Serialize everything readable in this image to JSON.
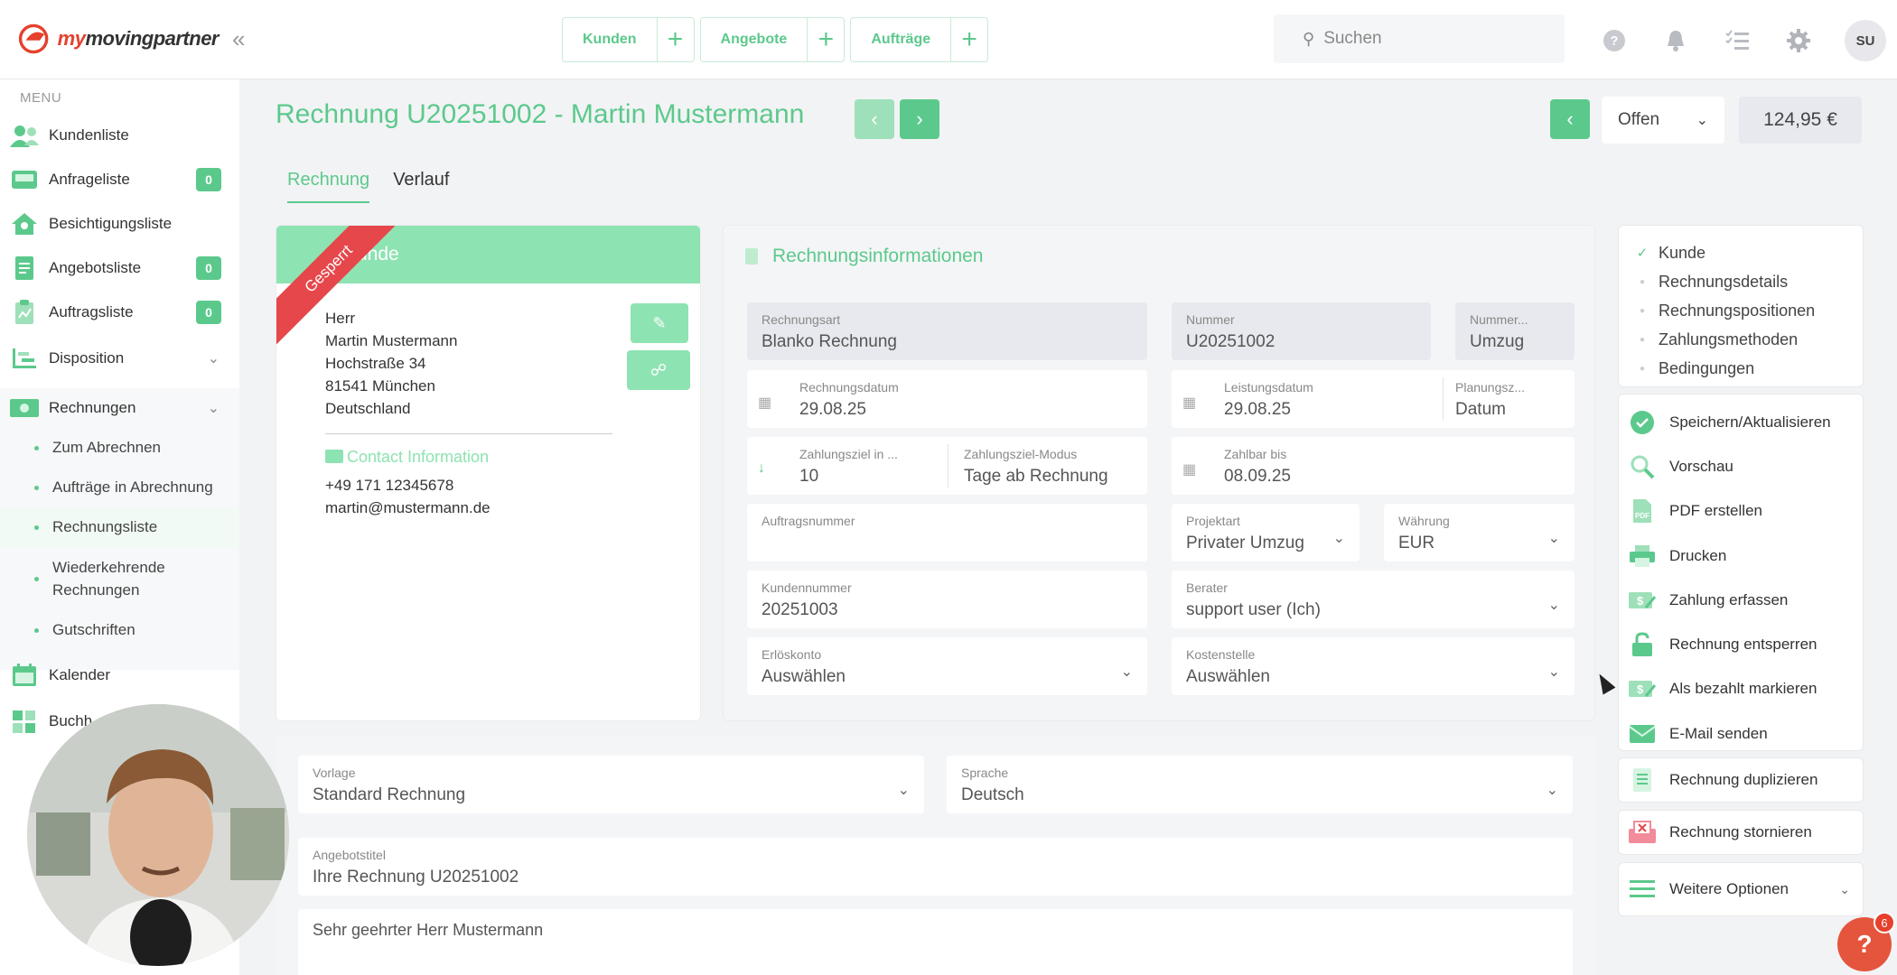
{
  "header": {
    "logo_text_prefix": "my",
    "logo_text": "movingpartner",
    "nav": [
      {
        "label": "Kunden"
      },
      {
        "label": "Angebote"
      },
      {
        "label": "Aufträge"
      }
    ],
    "search_placeholder": "Suchen",
    "avatar_initials": "SU"
  },
  "sidebar": {
    "menu_title": "MENU",
    "items": [
      {
        "label": "Kundenliste",
        "icon": "users-icon"
      },
      {
        "label": "Anfrageliste",
        "icon": "inbox-icon",
        "badge": "0"
      },
      {
        "label": "Besichtigungsliste",
        "icon": "house-icon"
      },
      {
        "label": "Angebotsliste",
        "icon": "document-icon",
        "badge": "0"
      },
      {
        "label": "Auftragsliste",
        "icon": "clipboard-icon",
        "badge": "0"
      },
      {
        "label": "Disposition",
        "icon": "schedule-icon"
      },
      {
        "label": "Rechnungen",
        "icon": "money-icon"
      },
      {
        "label": "Kalender",
        "icon": "calendar-icon"
      },
      {
        "label": "Buchh",
        "icon": "calculator-icon"
      }
    ],
    "rechnungen_sub": [
      {
        "label": "Zum Abrechnen"
      },
      {
        "label": "Aufträge in Abrechnung"
      },
      {
        "label": "Rechnungsliste"
      },
      {
        "label": "Wiederkehrende Rechnungen",
        "label2": "Rechnungen"
      },
      {
        "label": "Gutschriften"
      }
    ]
  },
  "main": {
    "title": "Rechnung U20251002 - Martin Mustermann",
    "status": "Offen",
    "amount": "124,95 €",
    "tabs": [
      {
        "label": "Rechnung"
      },
      {
        "label": "Verlauf"
      }
    ]
  },
  "customer": {
    "header_label": "Kunde",
    "ribbon": "Gesperrt",
    "salutation": "Herr",
    "name": "Martin Mustermann",
    "street": "Hochstraße 34",
    "city": "81541 München",
    "country": "Deutschland",
    "contact_title": "Contact Information",
    "phone": "+49 171 12345678",
    "email": "martin@mustermann.de"
  },
  "invoice_info": {
    "title": "Rechnungsinformationen",
    "fields": {
      "rechnungsart": {
        "label": "Rechnungsart",
        "value": "Blanko Rechnung"
      },
      "nummer": {
        "label": "Nummer",
        "value": "U20251002"
      },
      "nummernkreis": {
        "label": "Nummer...",
        "value": "Umzug"
      },
      "rechnungsdatum": {
        "label": "Rechnungsdatum",
        "value": "29.08.25"
      },
      "leistungsdatum": {
        "label": "Leistungsdatum",
        "value": "29.08.25"
      },
      "planungszeitraum": {
        "label": "Planungsz...",
        "value": "Datum"
      },
      "zahlungsziel": {
        "label": "Zahlungsziel in ...",
        "value": "10"
      },
      "zahlungsziel_modus": {
        "label": "Zahlungsziel-Modus",
        "value": "Tage ab Rechnung"
      },
      "zahlbar_bis": {
        "label": "Zahlbar bis",
        "value": "08.09.25"
      },
      "auftragsnummer": {
        "label": "Auftragsnummer",
        "value": ""
      },
      "projektart": {
        "label": "Projektart",
        "value": "Privater Umzug"
      },
      "waehrung": {
        "label": "Währung",
        "value": "EUR"
      },
      "kundennummer": {
        "label": "Kundennummer",
        "value": "20251003"
      },
      "berater": {
        "label": "Berater",
        "value": "support user (Ich)"
      },
      "erloeskonto": {
        "label": "Erlöskonto",
        "value": "Auswählen"
      },
      "kostenstelle": {
        "label": "Kostenstelle",
        "value": "Auswählen"
      }
    }
  },
  "lower": {
    "vorlage": {
      "label": "Vorlage",
      "value": "Standard Rechnung"
    },
    "sprache": {
      "label": "Sprache",
      "value": "Deutsch"
    },
    "angebotstitel": {
      "label": "Angebotstitel",
      "value": "Ihre Rechnung U20251002"
    },
    "greeting": "Sehr geehrter Herr Mustermann"
  },
  "right_panel": {
    "steps": [
      {
        "label": "Kunde",
        "done": true
      },
      {
        "label": "Rechnungsdetails",
        "done": false
      },
      {
        "label": "Rechnungspositionen",
        "done": false
      },
      {
        "label": "Zahlungsmethoden",
        "done": false
      },
      {
        "label": "Bedingungen",
        "done": false
      }
    ],
    "actions": [
      {
        "label": "Speichern/Aktualisieren",
        "icon": "check-circle-icon"
      },
      {
        "label": "Vorschau",
        "icon": "magnifier-icon"
      },
      {
        "label": "PDF erstellen",
        "icon": "pdf-icon"
      },
      {
        "label": "Drucken",
        "icon": "printer-icon"
      },
      {
        "label": "Zahlung erfassen",
        "icon": "payment-icon"
      },
      {
        "label": "Rechnung entsperren",
        "icon": "unlock-icon"
      },
      {
        "label": "Als bezahlt markieren",
        "icon": "paid-icon"
      },
      {
        "label": "E-Mail senden",
        "icon": "mail-icon"
      }
    ],
    "duplicate": "Rechnung duplizieren",
    "cancel": "Rechnung stornieren",
    "more": "Weitere Optionen"
  },
  "help_badge": "6",
  "colors": {
    "accent": "#5cc98c",
    "accent_light": "#8ee3b2",
    "danger": "#e5474b"
  }
}
